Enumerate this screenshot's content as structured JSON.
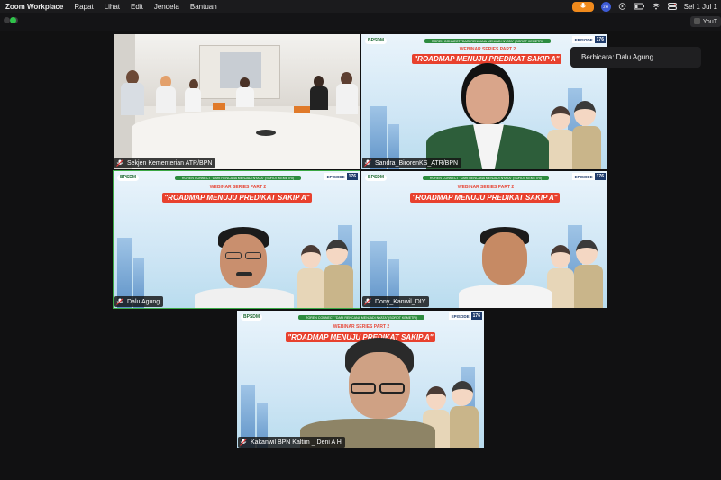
{
  "menubar": {
    "app": "Zoom Workplace",
    "items": [
      "Rapat",
      "Lihat",
      "Edit",
      "Jendela",
      "Bantuan"
    ],
    "clock": "Sel 1 Jul 1"
  },
  "browser_tab": "YouT",
  "speaker_toast": "Berbicara: Dalu Agung",
  "slide": {
    "logo": "BPSDM",
    "episode_label": "EPISODE",
    "episode_number": "176",
    "strip": "ROREN CONNECT \"DARI RENCANA MENJADI NYATA\" (SOROT KEMETRI)",
    "subtitle": "WEBINAR SERIES PART 2",
    "title": "\"ROADMAP MENUJU PREDIKAT SAKIP A\""
  },
  "tiles": [
    {
      "name": "Sekjen Kementerian ATR/BPN"
    },
    {
      "name": "Sandra_BirorenKS_ATR/BPN"
    },
    {
      "name": "Dalu Agung"
    },
    {
      "name": "Dony_Kanwil_DIY"
    },
    {
      "name": "Kakanwil BPN Kaltim _ Deni A H"
    }
  ],
  "colors": {
    "active_border": "#3aa845",
    "mic_accent": "#f08a1c",
    "title_red": "#e8412e"
  }
}
